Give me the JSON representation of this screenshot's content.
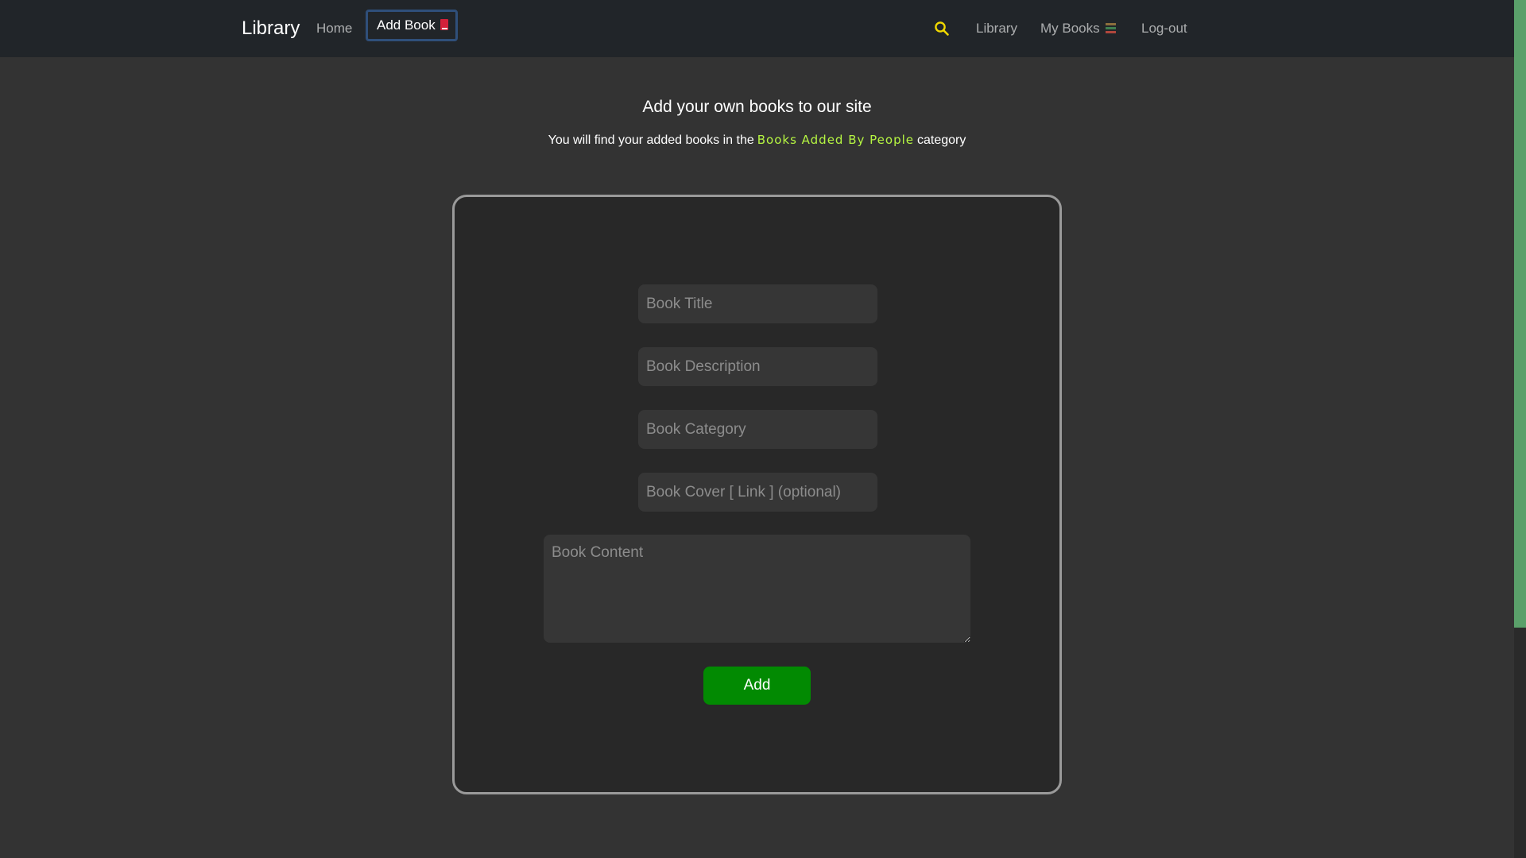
{
  "navbar": {
    "brand": "Library",
    "home_label": "Home",
    "add_book_label": "Add Book",
    "library_label": "Library",
    "my_books_label": "My Books",
    "logout_label": "Log-out",
    "active_item": "Add Book",
    "search_icon": "search-icon",
    "search_icon_color": "#f2d900"
  },
  "page": {
    "heading": "Add your own books to our site",
    "subheading_before": "You will find your added books in the",
    "subheading_highlight": "Books Added By People",
    "subheading_after": "category",
    "highlight_color": "#b5f542"
  },
  "form": {
    "title_placeholder": "Book Title",
    "description_placeholder": "Book Description",
    "category_placeholder": "Book Category",
    "cover_placeholder": "Book Cover [ Link ] (optional)",
    "content_placeholder": "Book Content",
    "submit_label": "Add",
    "submit_color": "#028a02"
  }
}
